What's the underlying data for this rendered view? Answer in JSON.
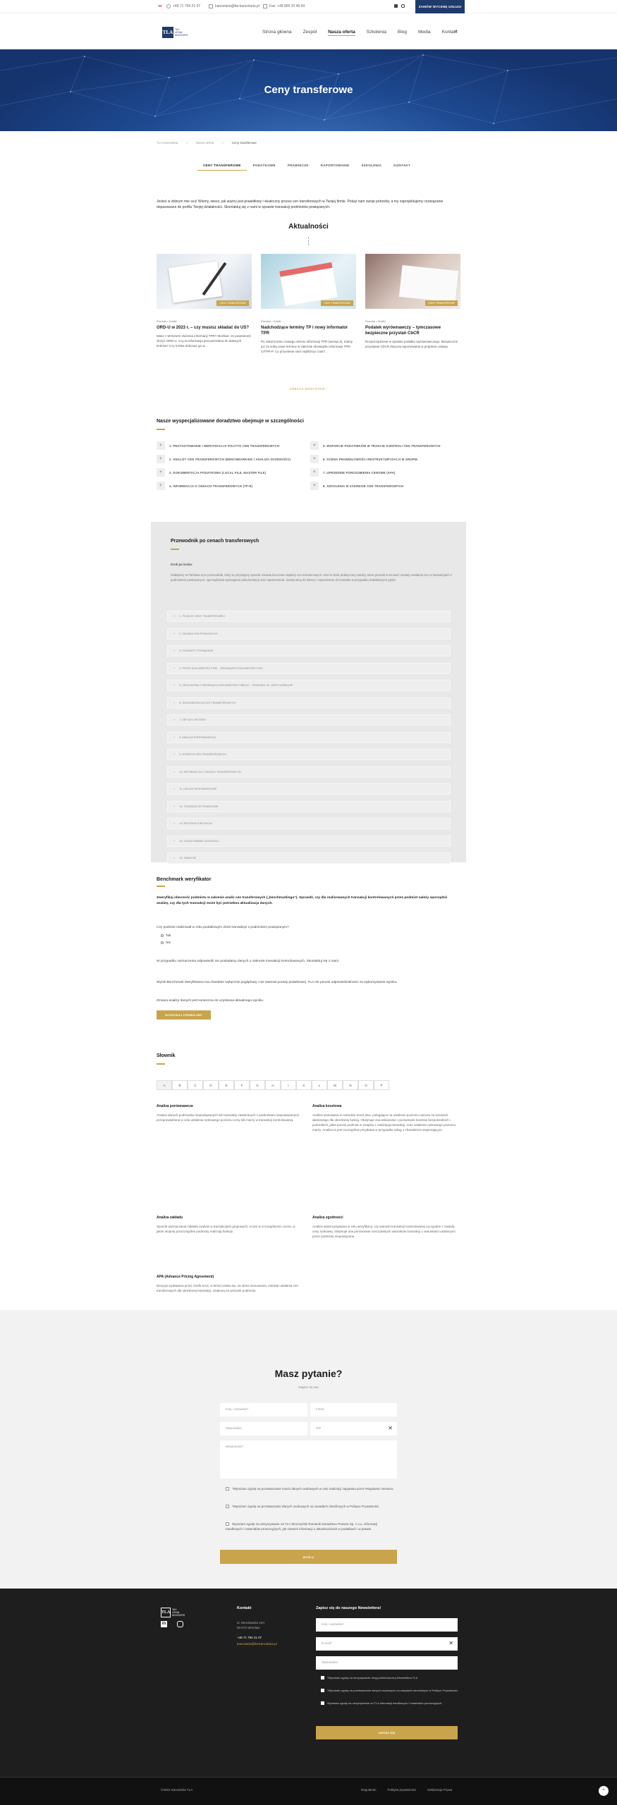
{
  "topbar": {
    "phone": "+48 71 794 21 07",
    "email": "kancelaria@tla-kancelaria.pl",
    "fax": "Fax: +48 800 20 46 64",
    "cta": "ZAMÓW WYCENĘ USŁUGI",
    "social": [
      "linkedin-icon",
      "instagram-icon"
    ]
  },
  "logo": {
    "mark": "TLA",
    "line1": "TAX",
    "line2": "LEGAL",
    "line3": "ADVISORS"
  },
  "nav": [
    "Strona główna",
    "Zespół",
    "Nasza oferta",
    "Szkolenia",
    "Blog",
    "Media",
    "Kontakt"
  ],
  "hero": {
    "title": "Ceny transferowe"
  },
  "breadcrumb": [
    "TLA Kancelaria",
    "Nasza oferta",
    "Ceny transferowe"
  ],
  "tabs": [
    "CENY TRANSFEROWE",
    "PODATKOWE",
    "PRAWNICZE",
    "RAPORTOWANIE",
    "SZKOLENIA",
    "KONTAKT"
  ],
  "intro": "Jesteś w dobrym mie scu! Wiemy, wiesz, jak ważny jest prawidłowy i skuteczny proces cen transferowych w Twojej firmie. Pokaż nam swoje potrzeby, a my zaprojektujemy rozwiązanie dopasowane do profilu Twojej działalności. Skontaktuj się z nami w sprawie transakcji podmiotów powiązanych.",
  "news": {
    "title": "Aktualności",
    "cards": [
      {
        "meta": "Rozmiar • Grafiki",
        "title": "ORD-U w 2023 r. – czy musisz składać do US?",
        "text": "Masz z terminem złożenia informacji TPR? Możliwe, że powinieneś złożyć ORD-U. Czy ta informacja jest potrzebna do dalszych kroków? Czy trzeba dokonać go w...",
        "badge": "CENY TRANSFEROWE"
      },
      {
        "meta": "Rozmiar • Grafiki",
        "title": "Nadchodzące terminy TP i nowy informator TPR",
        "text": "Po zakończeniu nowego okresu informacji TPR (wersja 3), mamy już za sobą nowe terminy w zakresie obowiązku informacji TPR-C/TPR-P. Co przyniesie nam najbliższy czas?...",
        "badge": "CENY TRANSFEROWE"
      },
      {
        "meta": "Rozmiar • Grafiki",
        "title": "Podatek wyrównawczy – tymczasowe bezpieczne przystań CbCR",
        "text": "Rozporządzenie w sprawie podatku wyrównawczego. Bezpieczne przystanie CbCR dotyczą raportowania w projekcie ustawy.",
        "badge": "CENY TRANSFEROWE"
      }
    ],
    "more": "ZOBACZ WSZYSTKIE"
  },
  "services": {
    "title": "Nasze wyspecjalizowane doradztwo obejmuje w szczególności",
    "left": [
      "1. PRZYGOTOWANIE I WERYFIKACJA POLITYK CEN TRANSFEROWYCH",
      "2. ANALIZY CEN TRANSFEROWYCH (BENCHMARKING I ANALIZA ZGODNOŚCI)",
      "3. DOKUMENTACJA PODATKOWA (LOCAL FILE, MASTER FILE)",
      "4. INFORMACJA O CENACH TRANSFEROWYCH (TP-R)"
    ],
    "right": [
      "5. WSPARCIE PODATNIKÓW W TRAKCIE KONTROLI CEN TRANSFEROWYCH",
      "6. OCENA PRAWIDŁOWOŚCI RESTRUKTURYZACJI W GRUPIE",
      "7. UPRZEDNIE POROZUMIENIA CENOWE (APA)",
      "8. SZKOLENIA W ZAKRESIE CEN TRANSFEROWYCH"
    ]
  },
  "guide": {
    "title": "Przewodnik po cenach transferowych",
    "subtitle": "Krok po kroku",
    "text": "Oddajemy w Państwa ręce przewodnik, który w przystępny sposób omawia kluczowe aspekty cen transferowych. Jest to zbiór praktycznej wiedzy, która pozwoli zrozumieć zasady ustalania cen w transakcjach z podmiotami powiązanymi, sporządzania wymaganej dokumentacji oraz raportowania. Zachęcamy do lektury i zapraszamy do kontaktu w przypadku dodatkowych pytań.",
    "items": [
      "1. POJĘCIE CENY TRANSFEROWEJ",
      "2. ZASADA CEN RYNKOWYCH",
      "3. PODMIOTY POWIĄZANE",
      "4. PROGI DOKUMENTACYJNE – OBOWIĄZEK DOKUMENTACYJNY",
      "5. ZWOLNIENIA Z OBOWIĄZKU DOKUMENTACYJNEGO – TRANSAKCJE „SAFE HARBOUR”",
      "6. DOKUMENTACJA CEN TRANSFEROWYCH",
      "7. METODY WYCENY",
      "8. ANALIZA PORÓWNAWCZA",
      "9. KOREKTA CEN TRANSFEROWYCH",
      "10. INFORMACJA O CENACH TRANSFEROWYCH",
      "11. USŁUGI NISKOMARŻOWE",
      "12. TRANSAKCJE FINANSOWE",
      "13. RESTRUKTURYZACJA",
      "14. OSZACOWANIE DOCHODU",
      "15. SANKCJE"
    ]
  },
  "benchmark": {
    "title": "Benchmark weryfikator",
    "lead": "Zweryfikuj obecność podmiotu w zakresie analiz cen transferowych („benchmarkingu”). Sprawdź, czy dla realizowanych transakcji kontrolowanych przez podmiot należy sporządzić analizę, czy dla tych transakcji może być potrzebna aktualizacja danych.",
    "question": "Czy podmiot realizował w roku podatkowym 2023 transakcje z podmiotem powiązanym?",
    "options": [
      "Tak",
      "Nie"
    ],
    "note1": "W przypadku zaznaczenia odpowiedzi nie posiadamy danych o zakresie transakcji kontrolowanych. Skontaktuj się z nami.",
    "note2": "Wynik Benchmark Weryfikatora ma charakter wyłącznie poglądowy i nie stanowi porady podatkowej. TLA nie ponosi odpowiedzialności za wykorzystanie wyniku.",
    "note3": "Zmiana analizy danych jest konieczna do uzyskania aktualnego wyniku.",
    "button": "WYSZUKAJ FORMULARZ"
  },
  "glossary": {
    "title": "Słownik",
    "letters": [
      "A",
      "B",
      "C",
      "D",
      "E",
      "F",
      "G",
      "H",
      "I",
      "K",
      "L",
      "M",
      "N",
      "O",
      "P"
    ],
    "entries": [
      {
        "term": "Analiza porównawcza",
        "def": "Analiza danych podmiotów niepowiązanych lub transakcji zawieranych z podmiotami niepowiązanymi, przeprowadzana w celu ustalenia rynkowego poziomu ceny lub marży w transakcji kontrolowanej."
      },
      {
        "term": "Analiza kosztowa",
        "def": "Analiza stosowana w metodzie koszt plus, polegająca na ustaleniu poziomu narzutu na kosztach właściwego dla określonej funkcji. Obejmuje ona wskazanie i porównanie kosztów bezpośrednich i pośrednich, jakie ponosi podmiot w związku z realizacją transakcji, oraz ustalenie rynkowego poziomu marży. Analiza ta jest szczególnie przydatna w przypadku usług o charakterze wspierającym."
      },
      {
        "term": "Analiza zakładu",
        "def": "Sposób wyznaczania zakładu zysków w transakcjach grupowych, w tym w szczególności ocena, w jakim stopniu poszczególne podmioty realizują funkcje."
      },
      {
        "term": "Analiza zgodności",
        "def": "Analiza wykorzystywana w celu weryfikacji, czy warunki transakcji kontrolowanej są zgodne z zasadą ceny rynkowej; obejmuje ona porównanie rzeczywistych warunków transakcji z warunkami ustalonymi przez podmioty niepowiązane."
      },
      {
        "term": "APA (Advance Pricing Agreement)",
        "def": "Decyzja wydawana przez Szefa KAS, w której ustala się, na okres stosowania, metodę ustalania cen transferowych dla określonej transakcji, ustaloną na wniosek podmiotu."
      }
    ]
  },
  "contact": {
    "title": "Masz pytanie?",
    "subtitle": "Napisz do nas",
    "fields": {
      "name": "Imię i nazwisko*",
      "company": "Firma",
      "email": "Stanowisko",
      "phone": "Tel*",
      "message": "Wiadomość*"
    },
    "consents": [
      "*Wyrażam zgodę na przetwarzanie moich danych osobowych w celu realizacji zapytania przez Regulamin Serwisu.",
      "*Wyrażam zgodę na przetwarzanie danych osobowych na zasadach określonych w Polityce Prywatności.",
      "Wyrażam zgodę na otrzymywanie od TLA Stroczyński Romanik Doradztwo Prawne Sp. z o.o. informacji handlowych i materiałów promocyjnych, jak również informacji o aktualnościach w podatkach i w prawie."
    ],
    "button": "WYŚLIJ"
  },
  "footer": {
    "contact_title": "Kontakt",
    "address1": "ul. Wrocławska 15A",
    "address2": "50-072 Wrocław",
    "phone": "+48 71 794 21 07",
    "email": "kancelaria@tla-kancelaria.pl",
    "newsletter_title": "Zapisz się do naszego Newslettera!",
    "nl_name": "Imię i nazwisko*",
    "nl_email": "E-mail*",
    "nl_position": "Stanowisko",
    "nl_consents": [
      "*Wyrażam zgodę na otrzymywanie drogą elektroniczną Newslettera TLA.",
      "*Wyrażam zgodę na przetwarzanie danych osobowych na zasadach określonych w Polityce Prywatności.",
      "Wyrażam zgodę na otrzymywanie od TLA informacji handlowych i materiałów promocyjnych."
    ],
    "nl_button": "ZAPISZ SIĘ",
    "copyright": "©2024 Kancelaria TLA",
    "links": [
      "Regulamin",
      "Polityka prywatności",
      "Deklaracja Prywa"
    ]
  }
}
